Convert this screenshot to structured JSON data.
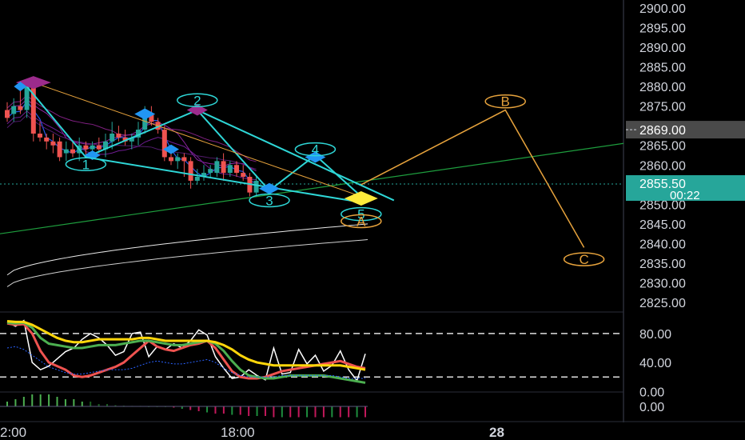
{
  "chart_data": [
    {
      "type": "candlestick",
      "panel": "price",
      "y_ticks": [
        "2900.00",
        "2895.00",
        "2890.00",
        "2885.00",
        "2880.00",
        "2875.00",
        "2870.00",
        "2865.00",
        "2860.00",
        "2850.00",
        "2845.00",
        "2840.00",
        "2835.00",
        "2830.00",
        "2825.00"
      ],
      "ylim": [
        2824,
        2901
      ],
      "x_ticks": [
        "2:00",
        "18:00",
        "28"
      ],
      "price_badge": "2869.00",
      "last_price_badge": "2855.50",
      "countdown_badge": "00:22",
      "candles": [
        {
          "o": 2874,
          "h": 2876,
          "l": 2871,
          "c": 2872
        },
        {
          "o": 2873,
          "h": 2877,
          "l": 2871,
          "c": 2875
        },
        {
          "o": 2875,
          "h": 2881,
          "l": 2873,
          "c": 2874
        },
        {
          "o": 2874,
          "h": 2878,
          "l": 2872,
          "c": 2880
        },
        {
          "o": 2881,
          "h": 2882,
          "l": 2866,
          "c": 2868
        },
        {
          "o": 2868,
          "h": 2871,
          "l": 2866,
          "c": 2867
        },
        {
          "o": 2867,
          "h": 2868,
          "l": 2864,
          "c": 2866
        },
        {
          "o": 2866,
          "h": 2868,
          "l": 2863,
          "c": 2865
        },
        {
          "o": 2866,
          "h": 2867,
          "l": 2861,
          "c": 2862
        },
        {
          "o": 2863,
          "h": 2866,
          "l": 2861,
          "c": 2864
        },
        {
          "o": 2864,
          "h": 2866,
          "l": 2862,
          "c": 2863
        },
        {
          "o": 2863,
          "h": 2867,
          "l": 2861,
          "c": 2865
        },
        {
          "o": 2865,
          "h": 2866,
          "l": 2862,
          "c": 2864
        },
        {
          "o": 2864,
          "h": 2866,
          "l": 2863,
          "c": 2865
        },
        {
          "o": 2865,
          "h": 2867,
          "l": 2863,
          "c": 2864
        },
        {
          "o": 2864,
          "h": 2868,
          "l": 2862,
          "c": 2866
        },
        {
          "o": 2866,
          "h": 2871,
          "l": 2864,
          "c": 2868
        },
        {
          "o": 2868,
          "h": 2870,
          "l": 2866,
          "c": 2867
        },
        {
          "o": 2867,
          "h": 2869,
          "l": 2865,
          "c": 2866
        },
        {
          "o": 2866,
          "h": 2868,
          "l": 2864,
          "c": 2867
        },
        {
          "o": 2867,
          "h": 2871,
          "l": 2865,
          "c": 2869
        },
        {
          "o": 2869,
          "h": 2875,
          "l": 2868,
          "c": 2874
        },
        {
          "o": 2873,
          "h": 2875,
          "l": 2870,
          "c": 2871
        },
        {
          "o": 2871,
          "h": 2872,
          "l": 2868,
          "c": 2869
        },
        {
          "o": 2869,
          "h": 2870,
          "l": 2861,
          "c": 2862
        },
        {
          "o": 2862,
          "h": 2863,
          "l": 2860,
          "c": 2861
        },
        {
          "o": 2861,
          "h": 2863,
          "l": 2859,
          "c": 2862
        },
        {
          "o": 2862,
          "h": 2863,
          "l": 2857,
          "c": 2861
        },
        {
          "o": 2861,
          "h": 2862,
          "l": 2854,
          "c": 2856
        },
        {
          "o": 2856,
          "h": 2859,
          "l": 2855,
          "c": 2857
        },
        {
          "o": 2857,
          "h": 2860,
          "l": 2856,
          "c": 2858
        },
        {
          "o": 2858,
          "h": 2860,
          "l": 2857,
          "c": 2859
        },
        {
          "o": 2858,
          "h": 2862,
          "l": 2857,
          "c": 2861
        },
        {
          "o": 2861,
          "h": 2863,
          "l": 2856,
          "c": 2858
        },
        {
          "o": 2858,
          "h": 2861,
          "l": 2857,
          "c": 2860
        },
        {
          "o": 2860,
          "h": 2861,
          "l": 2857,
          "c": 2858
        },
        {
          "o": 2858,
          "h": 2860,
          "l": 2856,
          "c": 2857
        },
        {
          "o": 2857,
          "h": 2858,
          "l": 2852,
          "c": 2853
        },
        {
          "o": 2853,
          "h": 2857,
          "l": 2852,
          "c": 2856
        }
      ],
      "wave_labels": [
        {
          "label": "1",
          "x_index": 12,
          "y": 2860.2,
          "color": "#2ed6d6"
        },
        {
          "label": "2",
          "x_index": 29,
          "y": 2876.5,
          "color": "#2ed6d6"
        },
        {
          "label": "3",
          "x_index": 40,
          "y": 2851.0,
          "color": "#2ed6d6"
        },
        {
          "label": "4",
          "x_index": 47,
          "y": 2864.0,
          "color": "#2ed6d6"
        },
        {
          "label": "5",
          "x_index": 54,
          "y": 2847.5,
          "color": "#2ed6d6"
        },
        {
          "label": "A",
          "x_index": 54,
          "y": 2845.7,
          "color": "#e6a23c"
        },
        {
          "label": "B",
          "x_index": 76,
          "y": 2876.2,
          "color": "#e6a23c"
        },
        {
          "label": "C",
          "x_index": 88,
          "y": 2836.0,
          "color": "#e6a23c"
        }
      ],
      "abc_projection": [
        {
          "x_index": 54,
          "y": 2855.0
        },
        {
          "x_index": 76,
          "y": 2874.0
        },
        {
          "x_index": 88,
          "y": 2839.0
        }
      ],
      "colors": {
        "up": "#26a69a",
        "down": "#ef5350",
        "cyan": "#2ed6d6",
        "orange": "#e6a23c",
        "trend": "#1e9e3e",
        "marker_purple": "#9c2b8c",
        "marker_blue": "#2196f3",
        "marker_yellow": "#ffeb3b"
      }
    },
    {
      "type": "line",
      "panel": "oscillator",
      "y_ticks": [
        "80.00",
        "40.00",
        "0.00"
      ],
      "ylim": [
        -3,
        102
      ],
      "levels": [
        80,
        20
      ],
      "series": [
        {
          "color": "#ffffff",
          "values": [
            96,
            90,
            98,
            40,
            30,
            35,
            45,
            55,
            60,
            72,
            80,
            74,
            64,
            50,
            55,
            80,
            82,
            48,
            62,
            58,
            66,
            60,
            70,
            85,
            78,
            48,
            32,
            18,
            20,
            30,
            22,
            16,
            60,
            24,
            26,
            58,
            38,
            50,
            28,
            36,
            56,
            30,
            15,
            52
          ]
        },
        {
          "color": "#ef5350",
          "values": [
            94,
            92,
            93,
            80,
            56,
            40,
            35,
            30,
            22,
            20,
            22,
            26,
            30,
            34,
            40,
            50,
            60,
            70,
            62,
            58,
            56,
            60,
            64,
            66,
            70,
            60,
            44,
            28,
            20,
            18,
            18,
            20,
            24,
            28,
            30,
            32,
            34,
            36,
            38,
            40,
            42,
            38,
            34,
            32
          ]
        },
        {
          "color": "#4caf50",
          "values": [
            95,
            94,
            95,
            88,
            74,
            66,
            64,
            62,
            60,
            60,
            62,
            64,
            64,
            64,
            66,
            68,
            70,
            70,
            68,
            66,
            64,
            64,
            66,
            68,
            70,
            66,
            56,
            42,
            30,
            22,
            20,
            18,
            18,
            20,
            22,
            22,
            22,
            22,
            22,
            20,
            18,
            16,
            14,
            12
          ]
        },
        {
          "color": "#ffd60a",
          "values": [
            97,
            96,
            96,
            92,
            86,
            80,
            74,
            70,
            68,
            68,
            70,
            72,
            72,
            72,
            72,
            72,
            74,
            74,
            72,
            70,
            70,
            70,
            70,
            70,
            70,
            68,
            64,
            58,
            50,
            44,
            40,
            38,
            36,
            36,
            36,
            36,
            36,
            36,
            36,
            36,
            36,
            34,
            32,
            30
          ]
        },
        {
          "color": "#2962ff",
          "values": [
            60,
            62,
            58,
            50,
            42,
            34,
            30,
            26,
            24,
            24,
            26,
            28,
            30,
            30,
            30,
            32,
            36,
            40,
            42,
            40,
            38,
            38,
            40,
            42,
            44,
            40,
            32,
            26,
            22,
            20,
            20,
            20,
            20,
            22,
            22,
            22,
            22,
            22,
            22,
            22,
            20,
            18,
            18,
            18
          ]
        }
      ]
    },
    {
      "type": "bar",
      "panel": "histogram",
      "y_ticks": [
        "0.00"
      ],
      "values": [
        2,
        3,
        4,
        5,
        5,
        5,
        4,
        3,
        3,
        2,
        2,
        1,
        1,
        0.5,
        0.3,
        0.2,
        0.2,
        0,
        0,
        0,
        -0.5,
        -1,
        -1.5,
        -2,
        -2.5,
        -3,
        -3,
        -3.5,
        -3.5,
        -4,
        -4,
        -4,
        -4.5,
        -4.5,
        -4.5,
        -4.5,
        -4.5,
        -4.5,
        -4.5,
        -4.5,
        -4.5,
        -4.5,
        -4.5,
        -4.5
      ]
    }
  ]
}
